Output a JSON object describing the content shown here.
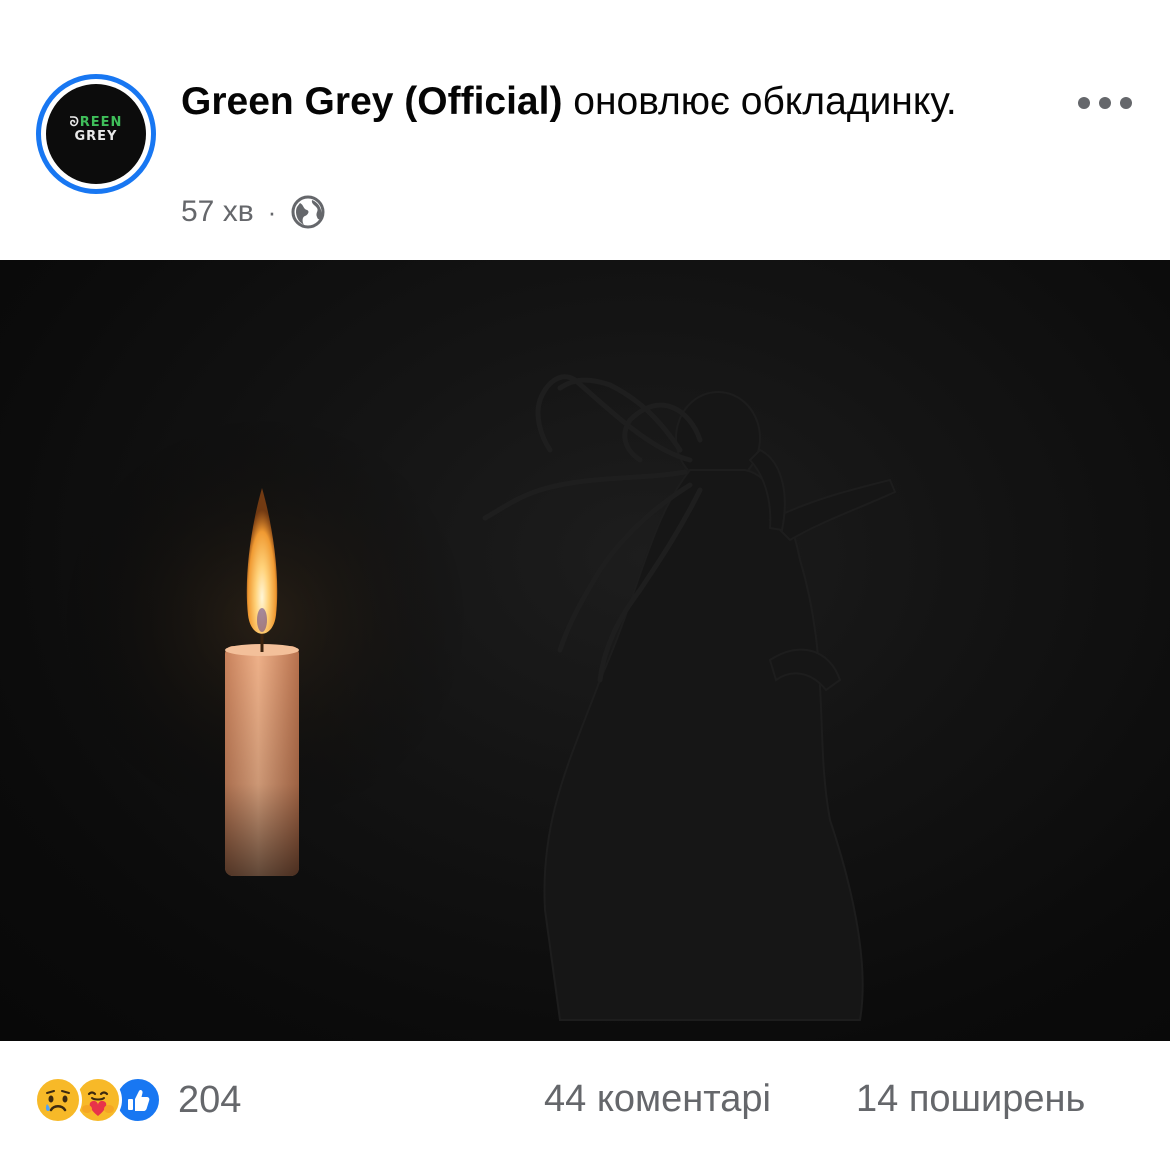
{
  "post": {
    "author": "Green Grey (Official)",
    "action": "оновлює обкладинку.",
    "time": "57 хв",
    "separator": "·",
    "audience_icon": "globe-icon",
    "menu_icon": "more-options-icon"
  },
  "avatar": {
    "line1_a": "ᘐ",
    "line1_b": "REEN",
    "line2": "GREY",
    "brand_color": "#3fbf5a",
    "ring_color": "#1877f2"
  },
  "footer": {
    "reaction_icons": [
      "sad-reaction-icon",
      "care-reaction-icon",
      "like-reaction-icon"
    ],
    "reaction_count": "204",
    "comments": "44 коментарі",
    "shares": "14 поширень"
  }
}
